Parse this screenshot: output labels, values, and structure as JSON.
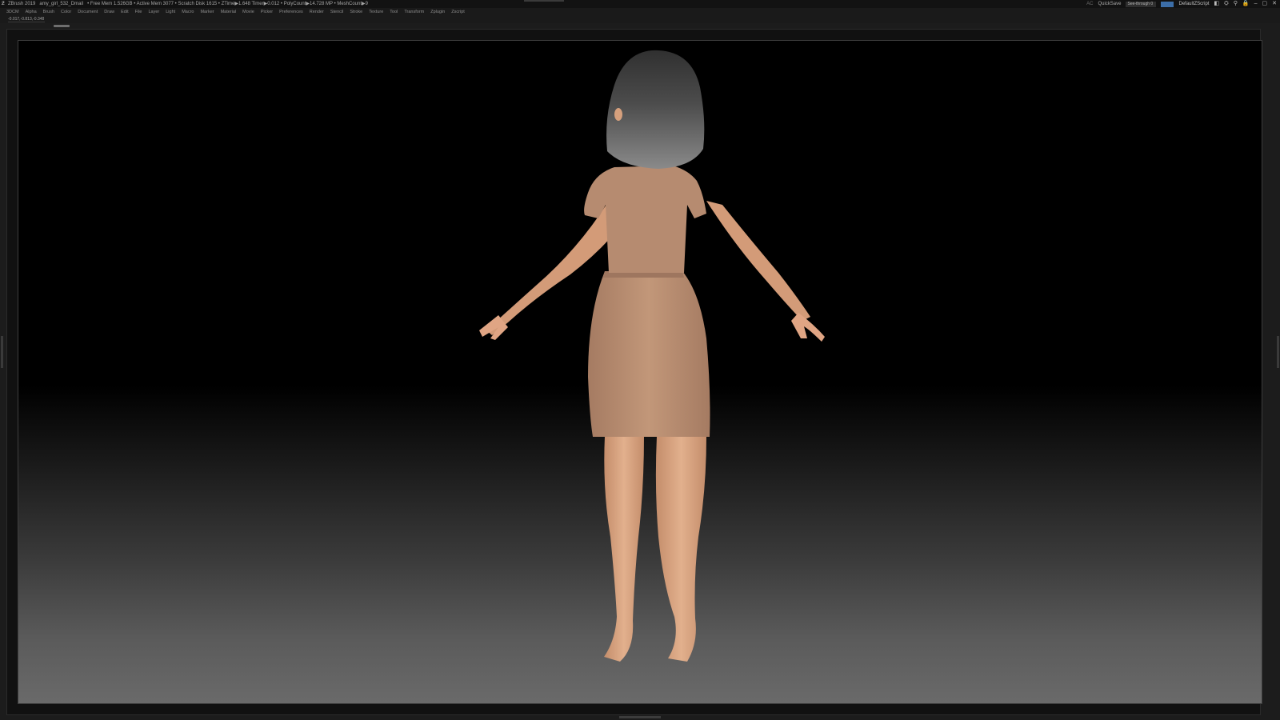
{
  "titlebar": {
    "app_title": "ZBrush 2019",
    "document": "amy_girl_532_Dmail",
    "stats": "• Free Mem 1.526GB • Active Mem 3077 • Scratch Disk 1615 • ZTime▶1.648 Timer▶0.012 • PolyCount▶14.728 MP • MeshCount▶9",
    "ac_label": "AC",
    "quicksave_label": "QuickSave",
    "seethrough_label": "See-through",
    "seethrough_value": "0",
    "menus_label": "Menus",
    "default_script_label": "DefaultZScript",
    "window_controls": [
      "◧",
      "⛭",
      "⚲",
      "🔒",
      "–",
      "▢",
      "✕"
    ]
  },
  "menubar": {
    "items": [
      "3DCM",
      "Alpha",
      "Brush",
      "Color",
      "Document",
      "Draw",
      "Edit",
      "File",
      "Layer",
      "Light",
      "Macro",
      "Marker",
      "Material",
      "Movie",
      "Picker",
      "Preferences",
      "Render",
      "Stencil",
      "Stroke",
      "Texture",
      "Tool",
      "Transform",
      "Zplugin",
      "Zscript"
    ]
  },
  "coord_readout": "-0.017,-0.813,-0.348",
  "colors": {
    "background": "#1c1c1c",
    "menus_button": "#3c6ea8",
    "skin": "#d9a27e",
    "dress": "#b98e72",
    "hair": "#6e6e6e"
  },
  "viewport": {
    "model": "female character in dress, back view, A-pose"
  }
}
